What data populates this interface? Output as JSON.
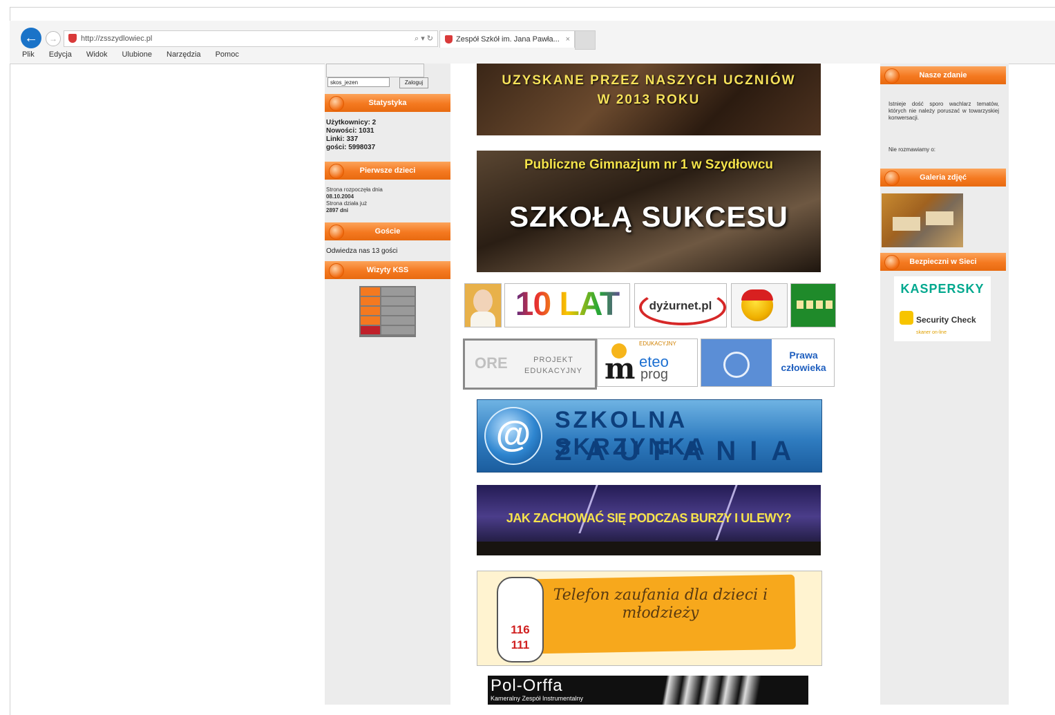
{
  "browser": {
    "url": "http://zsszydlowiec.pl",
    "address_actions": "⌕ ▾ ↻",
    "tab_title": "Zespół Szkół im. Jana Pawła...",
    "menu": [
      "Plik",
      "Edycja",
      "Widok",
      "Ulubione",
      "Narzędzia",
      "Pomoc"
    ]
  },
  "left_sidebar": {
    "login_select": "skos_jezen",
    "login_button": "Zaloguj",
    "stats_heading": "Statystyka",
    "stats": [
      "Użytkownicy: 2",
      "Nowości: 1031",
      "Linki: 337",
      "gości: 5998037"
    ],
    "birthdays_heading": "Pierwsze dzieci",
    "birthdays_lines": [
      "Strona rozpoczęła dnia",
      "08.10.2004",
      "Strona działa już",
      "2897 dni"
    ],
    "visitors_heading": "Goście",
    "visitors_text": "Odwiedza nas 13 gości",
    "counter_heading": "Wizyty KSS"
  },
  "right_sidebar": {
    "quote_heading": "Nasze zdanie",
    "quote_text": "Istnieje dość sporo wachlarz tematów, których nie należy poruszać w towarzyskiej konwersacji.",
    "quote_footer": "Nie rozmawiamy o:",
    "gallery_heading": "Galeria zdjęć",
    "security_heading": "Bezpieczni w Sieci",
    "kaspersky_label": "KASPERSKY",
    "security_check_label": "Security Check",
    "security_check_sub": "skaner on-line"
  },
  "banners": {
    "achievements_line1": "UZYSKANE PRZEZ NASZYCH UCZNIÓW",
    "achievements_line2": "W 2013 ROKU",
    "school_subtitle": "Publiczne Gimnazjum nr 1 w Szydłowcu",
    "school_title": "SZKOŁĄ SUKCESU",
    "ten_years": "10 LAT",
    "dyzurnet": "dyżurnet.pl",
    "ore_logo": "ORE",
    "ore_project": "PROJEKT\nEDUKACYJNY",
    "meteo_top": "EDUKACYJNY",
    "meteo_e": "eteo",
    "meteo_p": "prog",
    "un_text": "Prawa człowieka",
    "trust_line1": "SZKOLNA SKRZYNKA",
    "trust_line2": "ZAUFANIA",
    "storm": "JAK ZACHOWAĆ SIĘ PODCZAS BURZY I ULEWY?",
    "helpline": "Telefon zaufania dla dzieci i młodzieży",
    "helpline_digits": "116 111",
    "orff_title": "Pol-Orffa",
    "orff_sub": "Kameralny Zespół Instrumentalny"
  }
}
